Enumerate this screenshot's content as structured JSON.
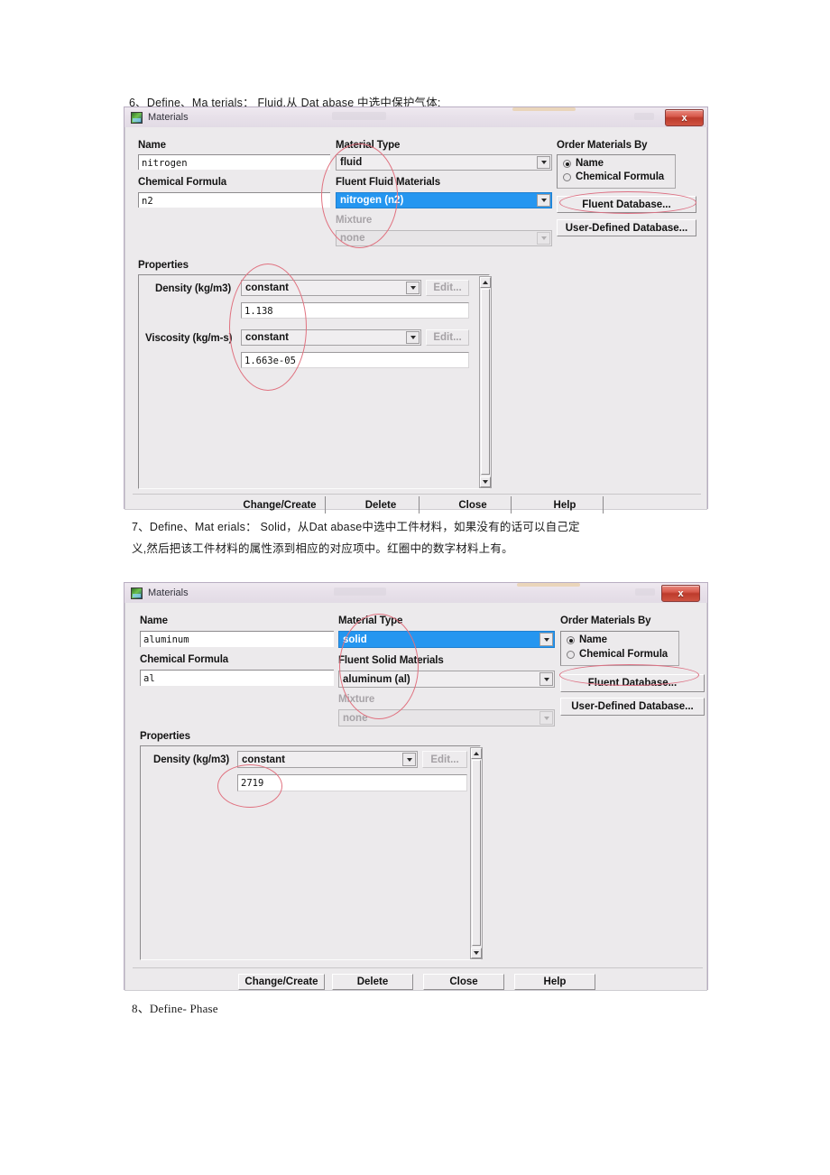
{
  "document": {
    "line_6": "6、Define、Ma terials： Fluid,从 Dat abase 中选中保护气体;",
    "line_7a": "7、Define、Mat erials： Solid，从Dat abase中选中工件材料，如果没有的话可以自己定",
    "line_7b": "义,然后把该工件材料的属性添到相应的对应项中。红圈中的数字材料上有。",
    "line_8": "8、Define- Phase"
  },
  "dialog1": {
    "title": "Materials",
    "close_label": "x",
    "labels": {
      "name": "Name",
      "chemical_formula": "Chemical Formula",
      "material_type": "Material Type",
      "fluent_materials": "Fluent Fluid Materials",
      "mixture": "Mixture",
      "order_materials_by": "Order Materials By",
      "properties": "Properties",
      "density": "Density (kg/m3)",
      "viscosity": "Viscosity (kg/m-s)"
    },
    "values": {
      "name": "nitrogen",
      "chemical_formula": "n2",
      "material_type": "fluid",
      "fluent_materials": "nitrogen (n2)",
      "mixture": "none",
      "density_method": "constant",
      "density_value": "1.138",
      "viscosity_method": "constant",
      "viscosity_value": "1.663e-05"
    },
    "radios": {
      "name": "Name",
      "chemical_formula": "Chemical Formula",
      "selected": "Name"
    },
    "buttons": {
      "fluent_database": "Fluent Database...",
      "user_defined_database": "User-Defined Database...",
      "edit_density": "Edit...",
      "edit_viscosity": "Edit...",
      "change_create": "Change/Create",
      "delete": "Delete",
      "close": "Close",
      "help": "Help"
    }
  },
  "dialog2": {
    "title": "Materials",
    "close_label": "x",
    "labels": {
      "name": "Name",
      "chemical_formula": "Chemical Formula",
      "material_type": "Material Type",
      "fluent_materials": "Fluent Solid Materials",
      "mixture": "Mixture",
      "order_materials_by": "Order Materials By",
      "properties": "Properties",
      "density": "Density (kg/m3)"
    },
    "values": {
      "name": "aluminum",
      "chemical_formula": "al",
      "material_type": "solid",
      "fluent_materials": "aluminum (al)",
      "mixture": "none",
      "density_method": "constant",
      "density_value": "2719"
    },
    "radios": {
      "name": "Name",
      "chemical_formula": "Chemical Formula",
      "selected": "Name"
    },
    "buttons": {
      "fluent_database": "Fluent Database...",
      "user_defined_database": "User-Defined Database...",
      "edit_density": "Edit...",
      "change_create": "Change/Create",
      "delete": "Delete",
      "close": "Close",
      "help": "Help"
    }
  },
  "colors": {
    "selection_blue": "#2596f0",
    "annotation_red": "#e0717f",
    "close_button_red": "#bd3b2c",
    "dialog_face": "#eceaec"
  }
}
